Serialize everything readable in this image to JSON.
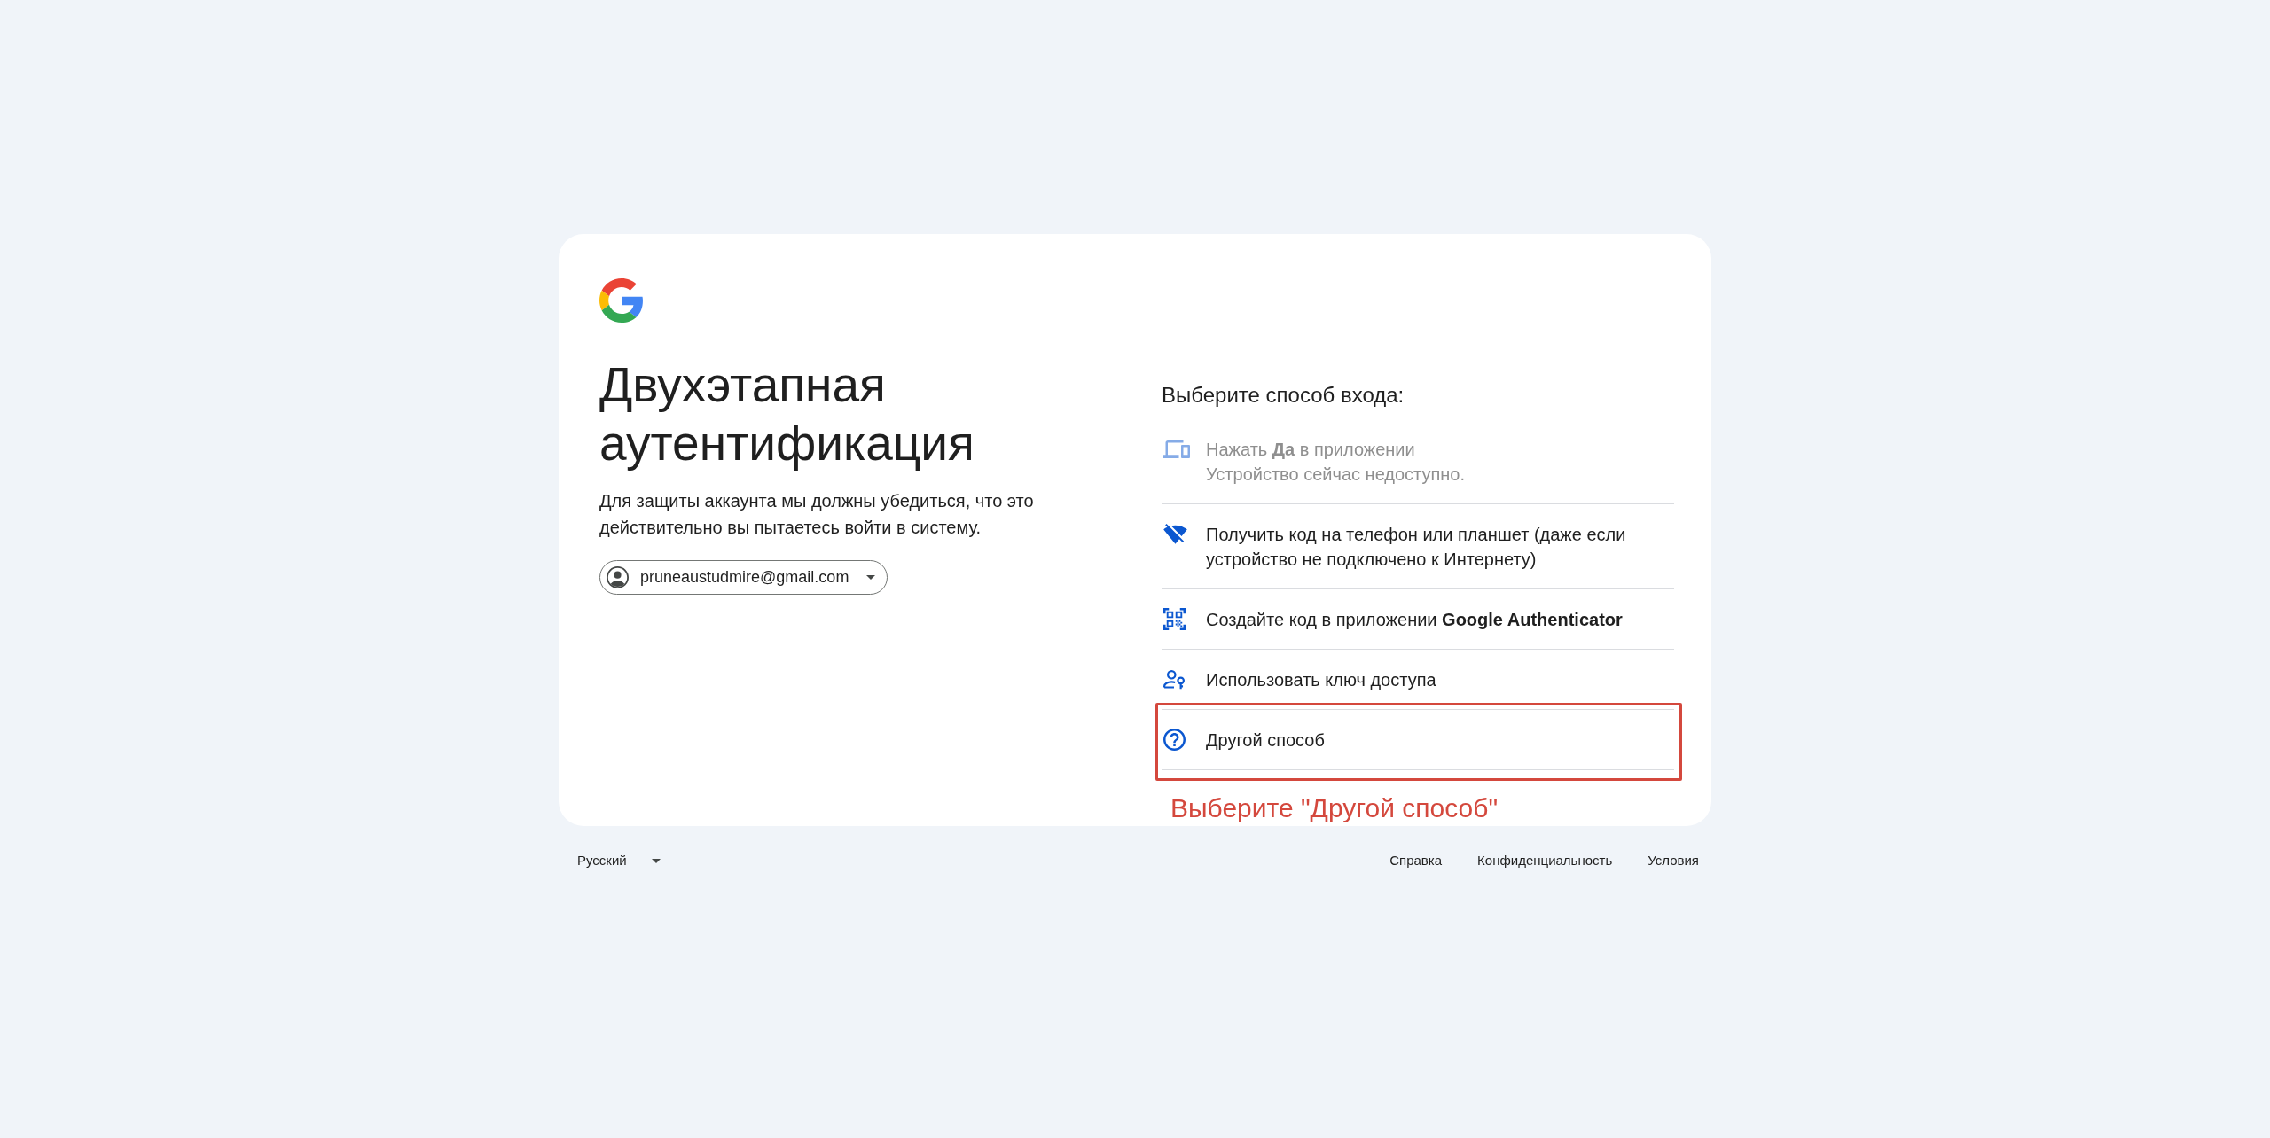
{
  "title": "Двухэтапная аутентификация",
  "description": "Для защиты аккаунта мы должны убедиться, что это действительно вы пытаетесь войти в систему.",
  "account": {
    "email": "pruneaustudmire@gmail.com"
  },
  "options_heading": "Выберите способ входа:",
  "options": [
    {
      "kind": "prompt",
      "title": "Нажать **Да** в приложении",
      "subtitle": "Устройство сейчас недоступно.",
      "disabled": true,
      "highlighted": false
    },
    {
      "kind": "offline-code",
      "title": "Получить код на телефон или планшет (даже если устройство не подключено к Интернету)",
      "disabled": false,
      "highlighted": false
    },
    {
      "kind": "authenticator",
      "title": "Создайте код в приложении **Google Authenticator**",
      "disabled": false,
      "highlighted": false
    },
    {
      "kind": "passkey",
      "title": "Использовать ключ доступа",
      "disabled": false,
      "highlighted": false
    },
    {
      "kind": "other",
      "title": "Другой способ",
      "disabled": false,
      "highlighted": true
    }
  ],
  "annotation": {
    "text": "Выберите \"Другой способ\""
  },
  "footer": {
    "language": "Русский",
    "links": [
      "Справка",
      "Конфиденциальность",
      "Условия"
    ]
  }
}
